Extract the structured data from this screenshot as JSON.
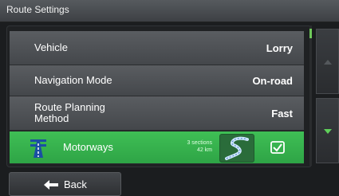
{
  "title": "Route Settings",
  "rows": [
    {
      "label": "Vehicle",
      "value": "Lorry"
    },
    {
      "label": "Navigation Mode",
      "value": "On-road"
    },
    {
      "label_line1": "Route Planning",
      "label_line2": "Method",
      "value": "Fast"
    }
  ],
  "motorways": {
    "label": "Motorways",
    "sections": "3 sections",
    "distance": "42 km",
    "checked": true,
    "icon": "motorway-icon",
    "accent": "#3fbf55"
  },
  "back_label": "Back",
  "icons": {
    "scroll_up": "chevron-up-icon",
    "scroll_down": "chevron-down-icon",
    "back": "arrow-left-icon",
    "route": "winding-road-icon",
    "check": "checkbox-checked-icon"
  }
}
